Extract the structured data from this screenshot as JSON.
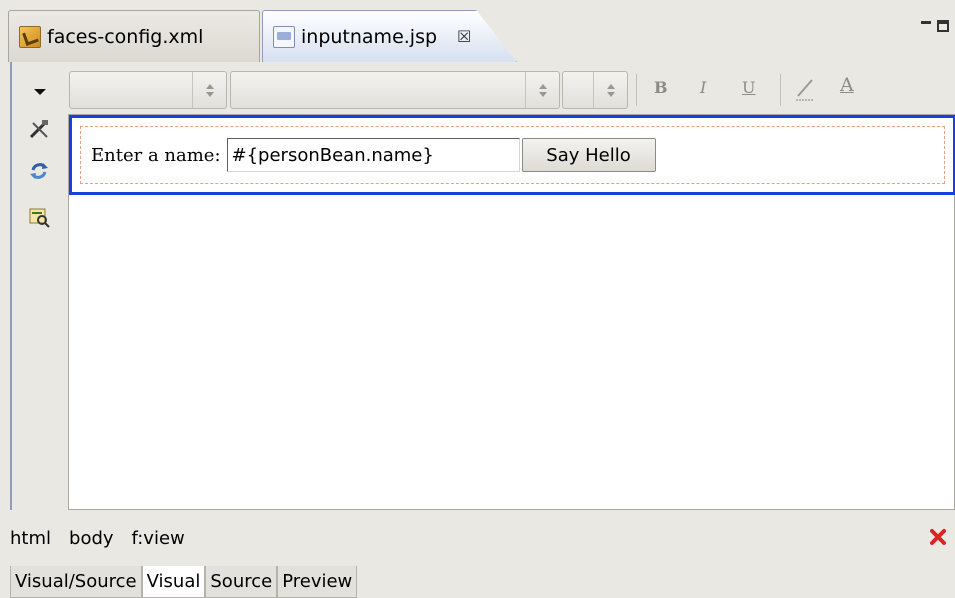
{
  "tabs": [
    {
      "label": "faces-config.xml",
      "icon": "xml-file-icon",
      "active": false
    },
    {
      "label": "inputname.jsp",
      "icon": "jsp-file-icon",
      "active": true,
      "close_glyph": "☒"
    }
  ],
  "toolbar": {
    "style_value": "",
    "font_value": "",
    "size_value": "",
    "bold_label": "B",
    "italic_label": "I",
    "underline_label": "U",
    "font_color_label": "A"
  },
  "canvas": {
    "label": "Enter a name:",
    "input_value": "#{personBean.name}",
    "button_label": "Say Hello",
    "selection_color": "#1a3fe0"
  },
  "breadcrumb": [
    "html",
    "body",
    "f:view"
  ],
  "view_tabs": [
    {
      "label": "Visual/Source",
      "active": false
    },
    {
      "label": "Visual",
      "active": true
    },
    {
      "label": "Source",
      "active": false
    },
    {
      "label": "Preview",
      "active": false
    }
  ]
}
